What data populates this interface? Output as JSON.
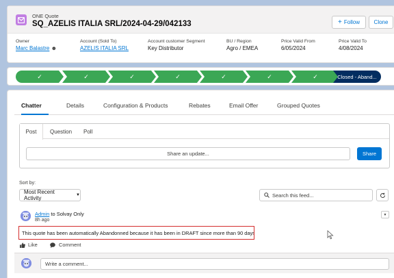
{
  "header": {
    "object_type": "ONE Quote",
    "title": "SQ_AZELIS ITALIA SRL/2024-04-29/042133",
    "follow_label": "Follow",
    "clone_label": "Clone",
    "fields": [
      {
        "label": "Owner",
        "value": "Marc Balastre",
        "link": true
      },
      {
        "label": "Account (Sold To)",
        "value": "AZELIS ITALIA SRL",
        "link": true
      },
      {
        "label": "Account customer Segment",
        "value": "Key Distributor",
        "link": false
      },
      {
        "label": "BU / Region",
        "value": "Agro / EMEA",
        "link": false
      },
      {
        "label": "Price Valid From",
        "value": "6/05/2024",
        "link": false
      },
      {
        "label": "Price Valid To",
        "value": "4/08/2024",
        "link": false
      }
    ]
  },
  "path": {
    "final_stage": "Closed - Aband..."
  },
  "tabs": [
    "Chatter",
    "Details",
    "Configuration & Products",
    "Rebates",
    "Email Offer",
    "Grouped Quotes"
  ],
  "publisher": {
    "tabs": [
      "Post",
      "Question",
      "Poll"
    ],
    "share_placeholder": "Share an update...",
    "share_label": "Share"
  },
  "feed": {
    "sort_label": "Sort by:",
    "sort_value": "Most Recent Activity",
    "search_placeholder": "Search this feed...",
    "post": {
      "author": "Admin",
      "target": "to Solvay Only",
      "time": "8h ago",
      "body": "This quote has been automatically Abandonned because it has been in DRAFT since more than 90 days.",
      "like_label": "Like",
      "comment_label": "Comment"
    },
    "comment_placeholder": "Write a comment..."
  },
  "colors": {
    "brand": "#0176d3",
    "path_complete": "#3ba755",
    "path_current": "#032d60",
    "highlight": "#d42d2d",
    "object_icon": "#c17ee2"
  }
}
